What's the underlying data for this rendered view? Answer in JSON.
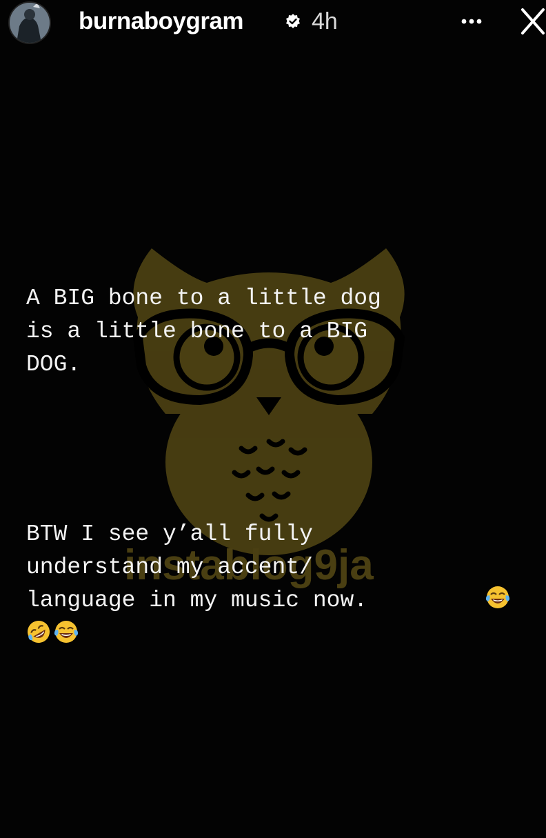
{
  "header": {
    "username": "burnaboygram",
    "time": "4h",
    "verified_icon": "verified-badge-icon",
    "more_icon": "more-options-icon",
    "close_icon": "close-icon"
  },
  "story": {
    "line1": "A BIG bone to a little dog",
    "line2": "is a little bone to a BIG",
    "line3": "DOG.",
    "line4": "BTW I see y’all fully",
    "line5": "understand my accent/",
    "line6": "language in my music now.",
    "emojis": [
      "face-with-tears-of-joy",
      "rolling-on-the-floor-laughing",
      "face-with-tears-of-joy"
    ]
  },
  "watermark": {
    "text": "instablog9ja",
    "color": "#6b5a1e"
  },
  "colors": {
    "background": "#030303",
    "text": "#f3f3f3"
  }
}
